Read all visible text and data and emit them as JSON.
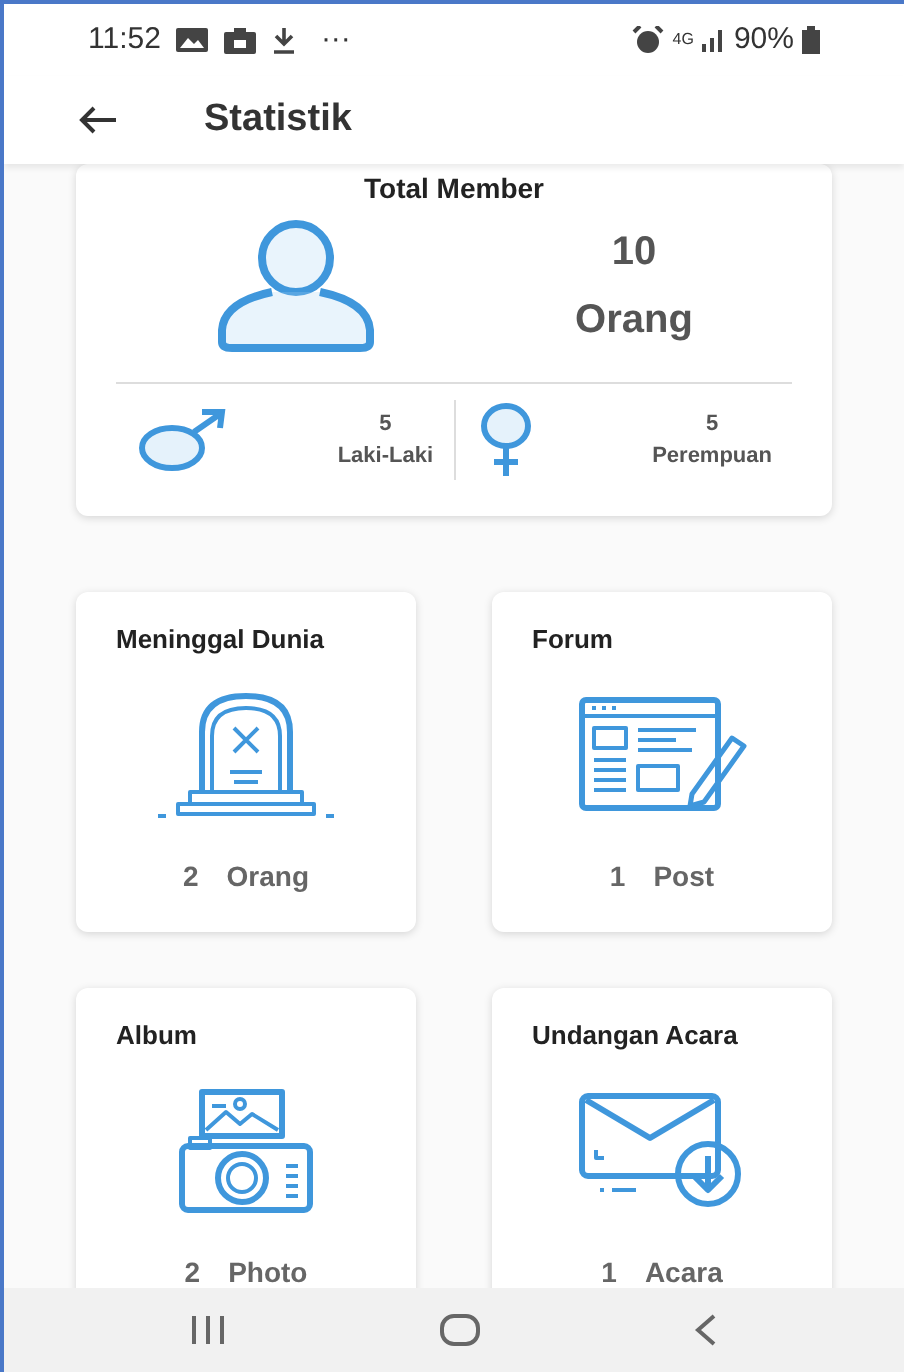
{
  "status_bar": {
    "time": "11:52",
    "more": "···",
    "network": "4G",
    "battery": "90%"
  },
  "app_bar": {
    "title": "Statistik"
  },
  "total_card": {
    "title": "Total Member",
    "count": "10",
    "unit": "Orang",
    "genders": [
      {
        "kind": "male",
        "count": "5",
        "label": "Laki-Laki"
      },
      {
        "kind": "female",
        "count": "5",
        "label": "Perempuan"
      }
    ]
  },
  "stat_cards": [
    {
      "kind": "grave",
      "title": "Meninggal Dunia",
      "count": "2",
      "unit": "Orang"
    },
    {
      "kind": "forum",
      "title": "Forum",
      "count": "1",
      "unit": "Post"
    },
    {
      "kind": "album",
      "title": "Album",
      "count": "2",
      "unit": "Photo"
    },
    {
      "kind": "invitation",
      "title": "Undangan Acara",
      "count": "1",
      "unit": "Acara"
    }
  ]
}
